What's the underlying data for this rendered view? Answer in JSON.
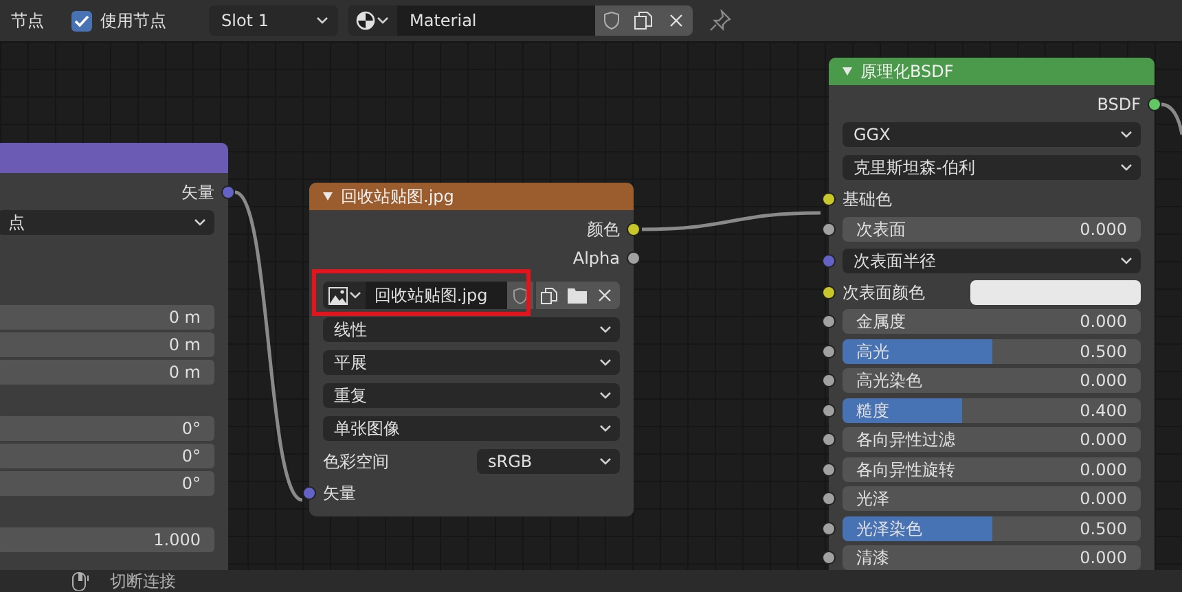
{
  "header": {
    "editor_label": "节点",
    "use_nodes": {
      "label": "使用节点",
      "checked": true
    },
    "slot": "Slot 1",
    "material": "Material"
  },
  "left_node": {
    "color": "#6c5bb5",
    "groups": [
      [
        {
          "kind": "output",
          "label": "矢量",
          "color": "#6363c7"
        },
        {
          "kind": "dropdown",
          "value": "点"
        }
      ],
      [
        {
          "kind": "field",
          "value": "0 m"
        },
        {
          "kind": "field",
          "value": "0 m"
        },
        {
          "kind": "field",
          "value": "0 m"
        }
      ],
      [
        {
          "kind": "field",
          "value": "0°"
        },
        {
          "kind": "field",
          "value": "0°"
        },
        {
          "kind": "field",
          "value": "0°"
        }
      ],
      [
        {
          "kind": "field",
          "value": "1.000"
        }
      ]
    ]
  },
  "image_node": {
    "title": "回收站贴图.jpg",
    "color": "#9b5c2e",
    "rows": [
      {
        "kind": "output",
        "label": "颜色",
        "color": "#c7c729"
      },
      {
        "kind": "output",
        "label": "Alpha",
        "color": "#a1a1a1"
      },
      {
        "kind": "image_selector",
        "value": "回收站贴图.jpg",
        "highlighted": true
      },
      {
        "kind": "dropdown",
        "value": "线性"
      },
      {
        "kind": "dropdown",
        "value": "平展"
      },
      {
        "kind": "dropdown",
        "value": "重复"
      },
      {
        "kind": "dropdown",
        "value": "单张图像"
      },
      {
        "kind": "label_dropdown",
        "label": "色彩空间",
        "value": "sRGB"
      },
      {
        "kind": "input",
        "label": "矢量",
        "color": "#6363c7"
      }
    ]
  },
  "bsdf_node": {
    "title": "原理化BSDF",
    "color": "#4b9a4b",
    "rows": [
      {
        "kind": "output",
        "label": "BSDF",
        "color": "#63c763"
      },
      {
        "kind": "dropdown",
        "value": "GGX"
      },
      {
        "kind": "dropdown",
        "value": "克里斯坦森-伯利"
      },
      {
        "kind": "input",
        "label": "基础色",
        "color": "#c7c729"
      },
      {
        "kind": "slider",
        "label": "次表面",
        "value": "0.000",
        "level": 0,
        "color": "#a1a1a1"
      },
      {
        "kind": "dropdown",
        "value": "次表面半径",
        "color": "#6363c7"
      },
      {
        "kind": "swatch",
        "label": "次表面颜色",
        "color": "#c7c729"
      },
      {
        "kind": "slider",
        "label": "金属度",
        "value": "0.000",
        "level": 0,
        "color": "#a1a1a1"
      },
      {
        "kind": "slider",
        "label": "高光",
        "value": "0.500",
        "level": 0.5,
        "color": "#a1a1a1"
      },
      {
        "kind": "slider",
        "label": "高光染色",
        "value": "0.000",
        "level": 0,
        "color": "#a1a1a1"
      },
      {
        "kind": "slider",
        "label": "糙度",
        "value": "0.400",
        "level": 0.4,
        "color": "#a1a1a1"
      },
      {
        "kind": "slider",
        "label": "各向异性过滤",
        "value": "0.000",
        "level": 0,
        "color": "#a1a1a1"
      },
      {
        "kind": "slider",
        "label": "各向异性旋转",
        "value": "0.000",
        "level": 0,
        "color": "#a1a1a1"
      },
      {
        "kind": "slider",
        "label": "光泽",
        "value": "0.000",
        "level": 0,
        "color": "#a1a1a1"
      },
      {
        "kind": "slider",
        "label": "光泽染色",
        "value": "0.500",
        "level": 0.5,
        "color": "#a1a1a1"
      },
      {
        "kind": "slider",
        "label": "清漆",
        "value": "0.000",
        "level": 0,
        "color": "#a1a1a1"
      }
    ]
  },
  "status_bar": {
    "hint": "切断连接"
  }
}
